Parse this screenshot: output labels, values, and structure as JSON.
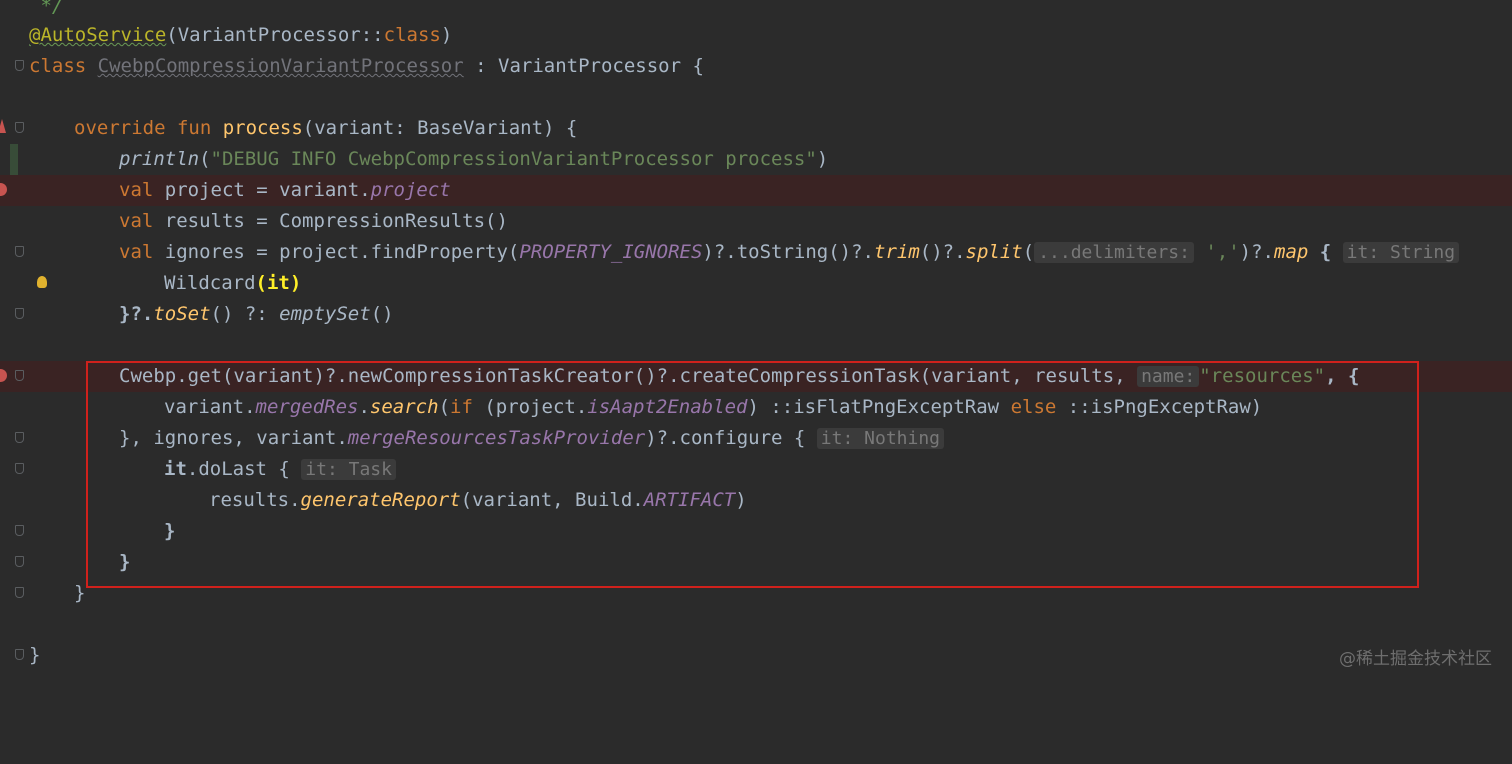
{
  "editor": {
    "language": "Kotlin",
    "lines": {
      "l0": " */",
      "l1_ann": "@AutoService",
      "l1_rest": "(VariantProcessor::",
      "l1_kw": "class",
      "l1_end": ")",
      "l2_kw": "class ",
      "l2_name": "CwebpCompressionVariantProcessor",
      "l2_rest": " : VariantProcessor {",
      "l4_kw": "override fun ",
      "l4_fn": "process",
      "l4_rest": "(variant: BaseVariant) {",
      "l5_fn": "println",
      "l5_open": "(",
      "l5_str": "\"DEBUG INFO CwebpCompressionVariantProcessor process\"",
      "l5_close": ")",
      "l6_kw": "val ",
      "l6_rest": "project = variant.",
      "l6_prop": "project",
      "l7_kw": "val ",
      "l7_rest": "results = CompressionResults()",
      "l8_kw": "val ",
      "l8_a": "ignores = project.findProperty(",
      "l8_const": "PROPERTY_IGNORES",
      "l8_b": ")?.toString()?.",
      "l8_trim": "trim",
      "l8_c": "()?.",
      "l8_split": "split",
      "l8_d": "(",
      "l8_hint1": "...delimiters:",
      "l8_str": " ','",
      "l8_e": ")?.",
      "l8_map": "map",
      "l8_f": " { ",
      "l8_hint2": "it: String",
      "l9_a": "Wildcard",
      "l9_b": "(it)",
      "l10_a": "}?.",
      "l10_toSet": "toSet",
      "l10_b": "() ?: ",
      "l10_empty": "emptySet",
      "l10_c": "()",
      "l12_a": "Cwebp.get(variant)?.newCompressionTaskCreator()?.createCompressionTask(variant, results, ",
      "l12_hint": "name:",
      "l12_str": "\"resources\"",
      "l12_b": ", {",
      "l13_a": "variant.",
      "l13_prop": "mergedRes",
      "l13_b": ".",
      "l13_search": "search",
      "l13_c": "(",
      "l13_if": "if",
      "l13_d": " (project.",
      "l13_prop2": "isAapt2Enabled",
      "l13_e": ") ::isFlatPngExceptRaw ",
      "l13_else": "else",
      "l13_f": " ::isPngExceptRaw)",
      "l14_a": "}, ignores, variant.",
      "l14_prop": "mergeResourcesTaskProvider",
      "l14_b": ")?.configure { ",
      "l14_hint": "it: Nothing",
      "l15_a": "it",
      "l15_b": ".doLast { ",
      "l15_hint": "it: Task",
      "l16_a": "results.",
      "l16_fn": "generateReport",
      "l16_b": "(variant, Build.",
      "l16_const": "ARTIFACT",
      "l16_c": ")",
      "l17": "}",
      "l18": "}",
      "l19": "}",
      "l21": "}"
    }
  },
  "watermark": "@稀土掘金技术社区",
  "colors": {
    "background": "#2b2b2b",
    "keyword": "#cc7832",
    "function": "#ffc66d",
    "string": "#6a8759",
    "property": "#9876aa",
    "highlight_box": "#d0211c",
    "breakpoint": "#c75450"
  }
}
